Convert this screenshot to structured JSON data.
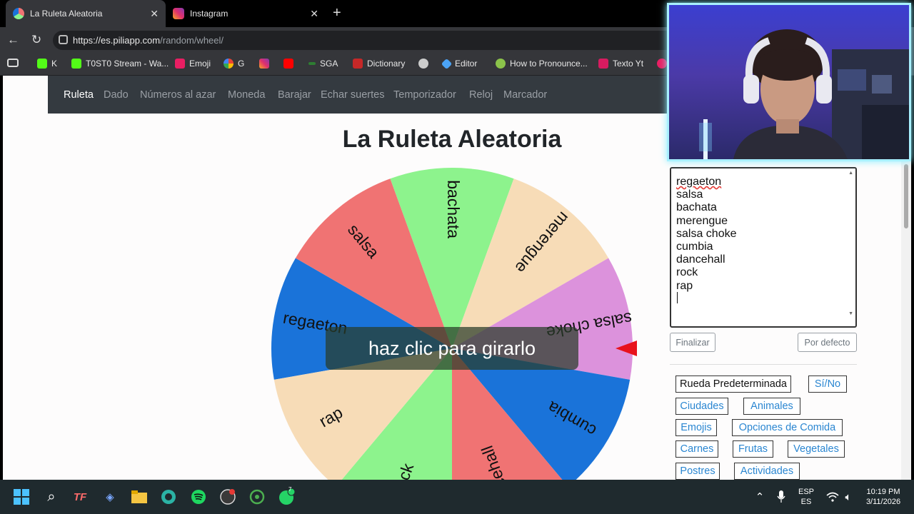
{
  "browser": {
    "tabs": [
      {
        "title": "La Ruleta Aleatoria",
        "active": true
      },
      {
        "title": "Instagram",
        "active": false
      }
    ],
    "url_host": "https://es.piliapp.com",
    "url_path": "/random/wheel/",
    "bookmarks": [
      "K",
      "T0ST0 Stream - Wa...",
      "Emoji",
      "G",
      "SGA",
      "Dictionary",
      "Editor",
      "How to Pronounce...",
      "Texto Yt"
    ]
  },
  "site_nav": {
    "items": [
      "Ruleta",
      "Dado",
      "Números al azar",
      "Moneda",
      "Barajar",
      "Echar suertes",
      "Temporizador",
      "Reloj",
      "Marcador"
    ],
    "active": "Ruleta"
  },
  "page_title": "La Ruleta Aleatoria",
  "wheel": {
    "spin_prompt": "haz clic para girarlo",
    "segments": [
      {
        "label": "regaeton",
        "color": "#1a73d9"
      },
      {
        "label": "salsa",
        "color": "#f07373"
      },
      {
        "label": "bachata",
        "color": "#8df38d"
      },
      {
        "label": "merengue",
        "color": "#f7dcb7"
      },
      {
        "label": "salsa choke",
        "color": "#dc92dc"
      },
      {
        "label": "cumbia",
        "color": "#1a73d9"
      },
      {
        "label": "dancehall",
        "color": "#f07373"
      },
      {
        "label": "rock",
        "color": "#8df38d"
      },
      {
        "label": "rap",
        "color": "#f7dcb7"
      }
    ],
    "pointer_color": "#e8121c"
  },
  "options_text": [
    "regaeton",
    "salsa",
    "bachata",
    "merengue",
    "salsa choke",
    "cumbia",
    "dancehall",
    "rock",
    "rap"
  ],
  "buttons": {
    "finish": "Finalizar",
    "default": "Por defecto"
  },
  "presets": [
    [
      "Rueda Predeterminada",
      "Sí/No"
    ],
    [
      "Ciudades",
      "Animales"
    ],
    [
      "Emojis",
      "Opciones de Comida"
    ],
    [
      "Carnes",
      "Frutas",
      "Vegetales"
    ],
    [
      "Postres",
      "Actividades"
    ]
  ],
  "taskbar": {
    "lang_top": "ESP",
    "lang_bottom": "ES",
    "time": "10:19 PM",
    "date": "3/11/2026",
    "whatsapp_badge": "7"
  }
}
